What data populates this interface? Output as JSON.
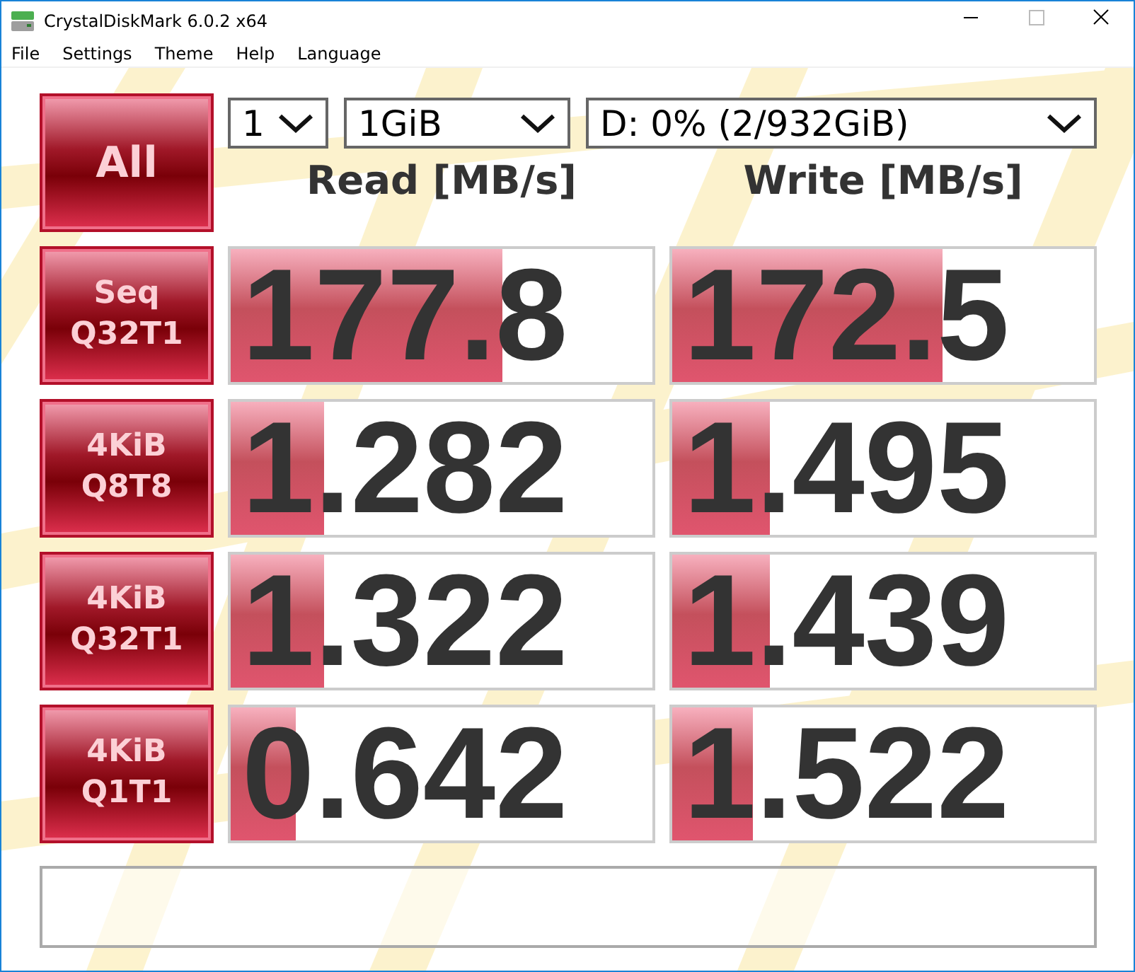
{
  "window": {
    "title": "CrystalDiskMark 6.0.2 x64"
  },
  "menu": [
    "File",
    "Settings",
    "Theme",
    "Help",
    "Language"
  ],
  "all_button": "All",
  "selectors": [
    {
      "value": "1"
    },
    {
      "value": "1GiB"
    },
    {
      "value": "D: 0% (2/932GiB)"
    }
  ],
  "headers": [
    "Read [MB/s]",
    "Write [MB/s]"
  ],
  "tests": [
    {
      "label": [
        "Seq",
        "Q32T1"
      ],
      "read": {
        "value": "177.8",
        "level": 0.645
      },
      "write": {
        "value": "172.5",
        "level": 0.64
      }
    },
    {
      "label": [
        "4KiB",
        "Q8T8"
      ],
      "read": {
        "value": "1.282",
        "level": 0.22
      },
      "write": {
        "value": "1.495",
        "level": 0.23
      }
    },
    {
      "label": [
        "4KiB",
        "Q32T1"
      ],
      "read": {
        "value": "1.322",
        "level": 0.22
      },
      "write": {
        "value": "1.439",
        "level": 0.23
      }
    },
    {
      "label": [
        "4KiB",
        "Q1T1"
      ],
      "read": {
        "value": "0.642",
        "level": 0.155
      },
      "write": {
        "value": "1.522",
        "level": 0.19
      }
    }
  ]
}
